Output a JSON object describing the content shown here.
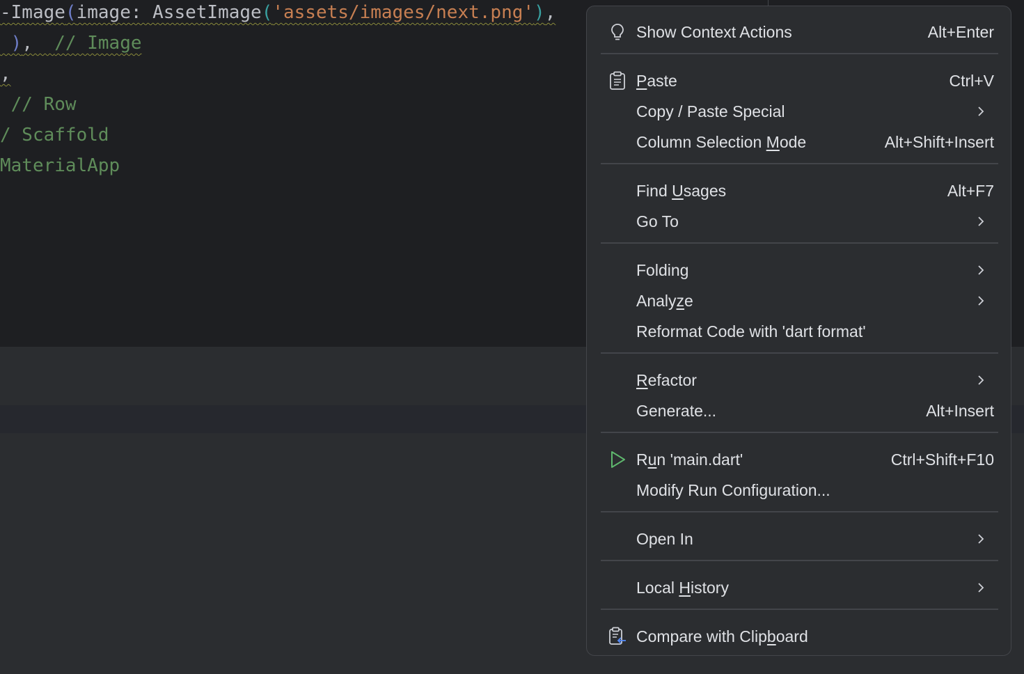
{
  "editor": {
    "lines": [
      {
        "segments": [
          {
            "text": "-Image",
            "cls": "c-plain"
          },
          {
            "text": "(",
            "cls": "c-paren"
          },
          {
            "text": "image: AssetImage",
            "cls": "c-plain"
          },
          {
            "text": "(",
            "cls": "c-paren2"
          },
          {
            "text": "'assets/images/next.png'",
            "cls": "c-string"
          },
          {
            "text": ")",
            "cls": "c-paren2"
          },
          {
            "text": ",",
            "cls": "c-plain"
          }
        ]
      },
      {
        "segments": [
          {
            "text": " )",
            "cls": "c-paren"
          },
          {
            "text": ",  ",
            "cls": "c-plain"
          },
          {
            "text": "// Image",
            "cls": "c-comment"
          }
        ]
      },
      {
        "segments": [
          {
            "text": ",",
            "cls": "c-plain"
          }
        ]
      },
      {
        "segments": [
          {
            "text": " // Row",
            "cls": "c-comment"
          }
        ]
      },
      {
        "segments": [
          {
            "text": "/ Scaffold",
            "cls": "c-comment"
          }
        ]
      },
      {
        "segments": [
          {
            "text": "MaterialApp",
            "cls": "c-comment"
          }
        ]
      }
    ]
  },
  "menu": {
    "show_context_actions": {
      "label": "Show Context Actions",
      "shortcut": "Alt+Enter",
      "icon": "lightbulb-icon"
    },
    "paste": {
      "label_pre": "",
      "label_ul": "P",
      "label_post": "aste",
      "shortcut": "Ctrl+V",
      "icon": "clipboard-icon"
    },
    "copy_paste_special": {
      "label": "Copy / Paste Special"
    },
    "column_selection_mode": {
      "label_pre": "Column Selection ",
      "label_ul": "M",
      "label_post": "ode",
      "shortcut": "Alt+Shift+Insert"
    },
    "find_usages": {
      "label_pre": "Find ",
      "label_ul": "U",
      "label_post": "sages",
      "shortcut": "Alt+F7"
    },
    "go_to": {
      "label": "Go To"
    },
    "folding": {
      "label": "Folding"
    },
    "analyze": {
      "label_pre": "Analy",
      "label_ul": "z",
      "label_post": "e"
    },
    "reformat": {
      "label": "Reformat Code with 'dart format'"
    },
    "refactor": {
      "label_pre": "",
      "label_ul": "R",
      "label_post": "efactor"
    },
    "generate": {
      "label": "Generate...",
      "shortcut": "Alt+Insert"
    },
    "run_main": {
      "label_pre": "R",
      "label_ul": "u",
      "label_post": "n 'main.dart'",
      "shortcut": "Ctrl+Shift+F10",
      "icon": "run-icon"
    },
    "modify_run": {
      "label": "Modify Run Configuration..."
    },
    "open_in": {
      "label": "Open In"
    },
    "local_history": {
      "label_pre": "Local ",
      "label_ul": "H",
      "label_post": "istory"
    },
    "compare_clipboard": {
      "label_pre": "Compare with Clip",
      "label_ul": "b",
      "label_post": "oard",
      "icon": "compare-clipboard-icon"
    }
  },
  "colors": {
    "menu_bg": "#2b2d30",
    "menu_border": "#43454a",
    "menu_text": "#dfe1e5",
    "run_icon_green": "#5fb86e",
    "compare_icon_blue": "#548af7"
  }
}
